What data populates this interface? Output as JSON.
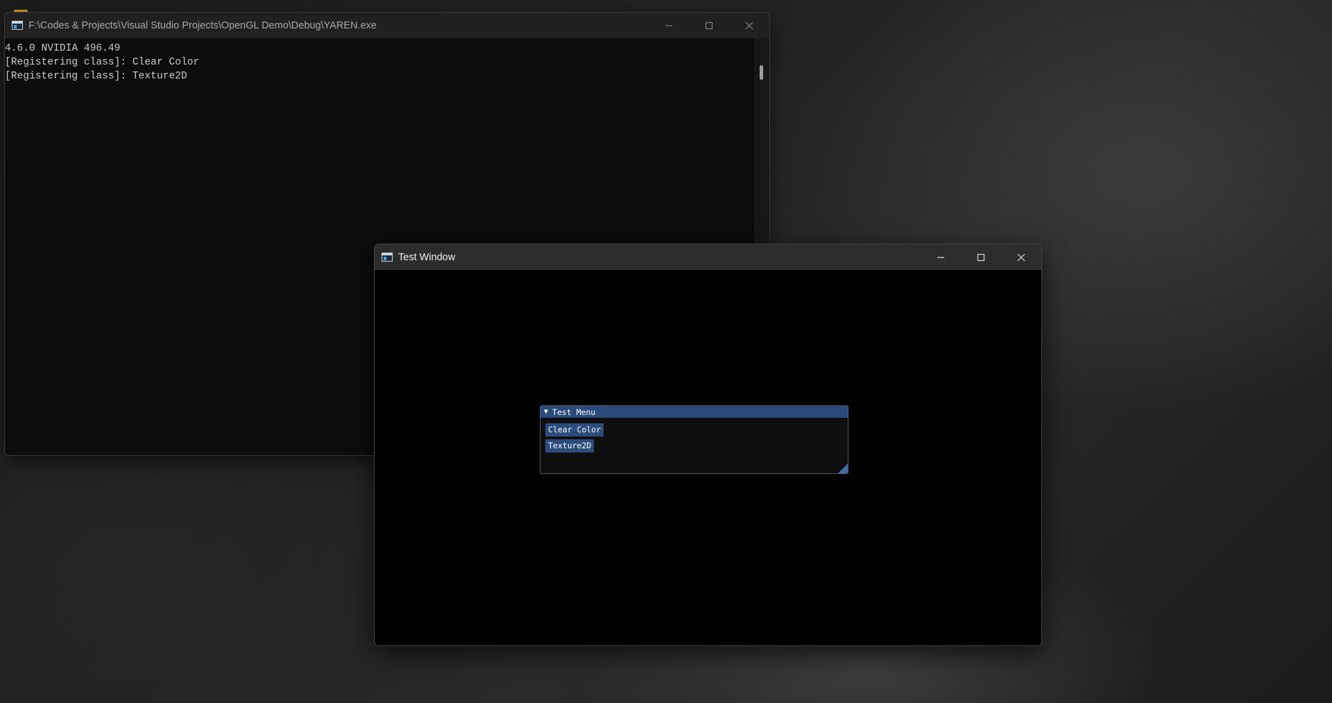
{
  "console_window": {
    "title": "F:\\Codes & Projects\\Visual Studio Projects\\OpenGL Demo\\Debug\\YAREN.exe",
    "lines": [
      "4.6.0 NVIDIA 496.49",
      "[Registering class]: Clear Color",
      "[Registering class]: Texture2D"
    ],
    "icon": "console-app-icon"
  },
  "test_window": {
    "title": "Test Window",
    "icon": "console-app-icon"
  },
  "test_menu": {
    "title": "Test Menu",
    "collapse_glyph": "▼",
    "buttons": [
      {
        "label": "Clear Color"
      },
      {
        "label": "Texture2D"
      }
    ],
    "colors": {
      "header": "#294a7a",
      "button": "#2b4d7c"
    }
  },
  "window_controls": {
    "minimize": "minimize-icon",
    "maximize": "maximize-icon",
    "close": "close-icon"
  }
}
